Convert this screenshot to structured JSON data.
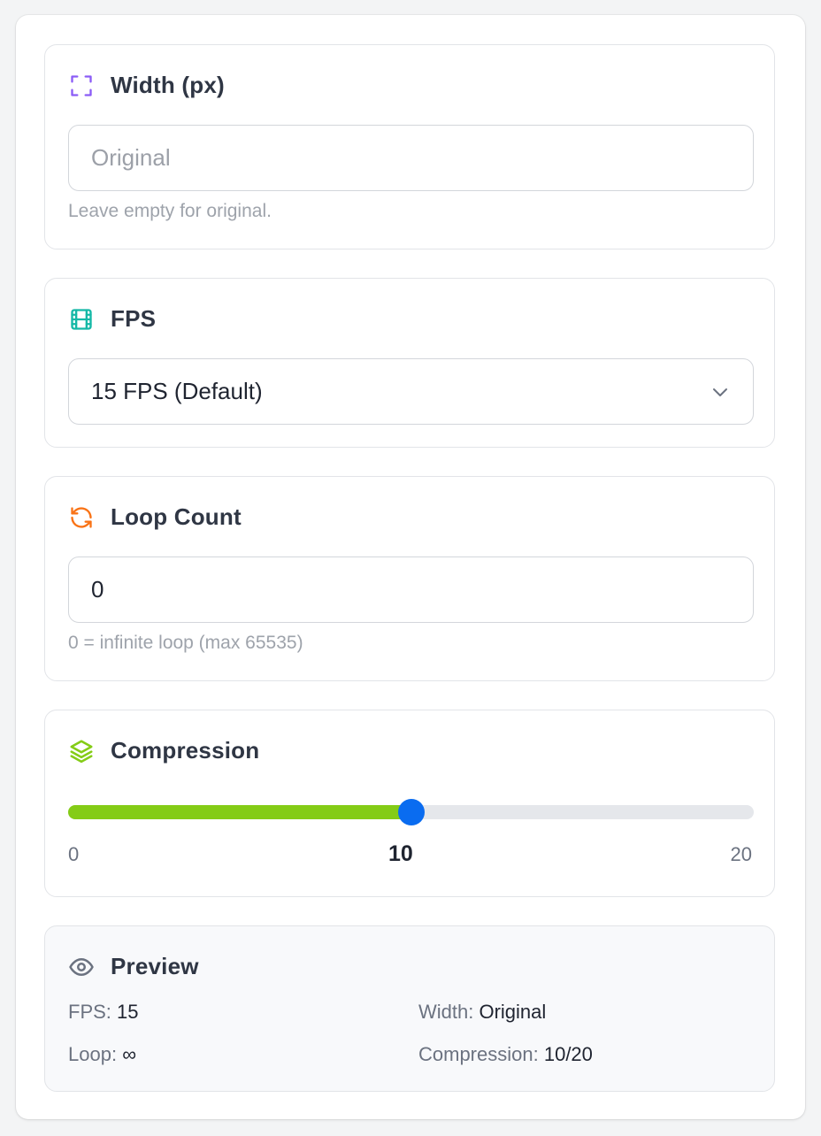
{
  "width": {
    "icon": "expand-corners-icon",
    "title": "Width (px)",
    "placeholder": "Original",
    "value": "",
    "hint": "Leave empty for original."
  },
  "fps": {
    "icon": "film-icon",
    "title": "FPS",
    "selected": "15 FPS (Default)"
  },
  "loop": {
    "icon": "refresh-icon",
    "title": "Loop Count",
    "value": "0",
    "hint": "0 = infinite loop (max 65535)"
  },
  "compression": {
    "icon": "layers-icon",
    "title": "Compression",
    "min": 0,
    "max": 20,
    "value": 10,
    "min_label": "0",
    "value_label": "10",
    "max_label": "20",
    "fill_color": "#84cc16",
    "thumb_color": "#0a6cf0"
  },
  "preview": {
    "icon": "eye-icon",
    "title": "Preview",
    "fps_label": "FPS:",
    "fps_value": "15",
    "width_label": "Width:",
    "width_value": "Original",
    "loop_label": "Loop:",
    "loop_value": "∞",
    "compression_label": "Compression:",
    "compression_value": "10/20"
  },
  "colors": {
    "width_icon": "#8b5cf6",
    "fps_icon": "#14b8a6",
    "loop_icon": "#f97316",
    "compression_icon": "#84cc16",
    "preview_icon": "#6b7280"
  }
}
